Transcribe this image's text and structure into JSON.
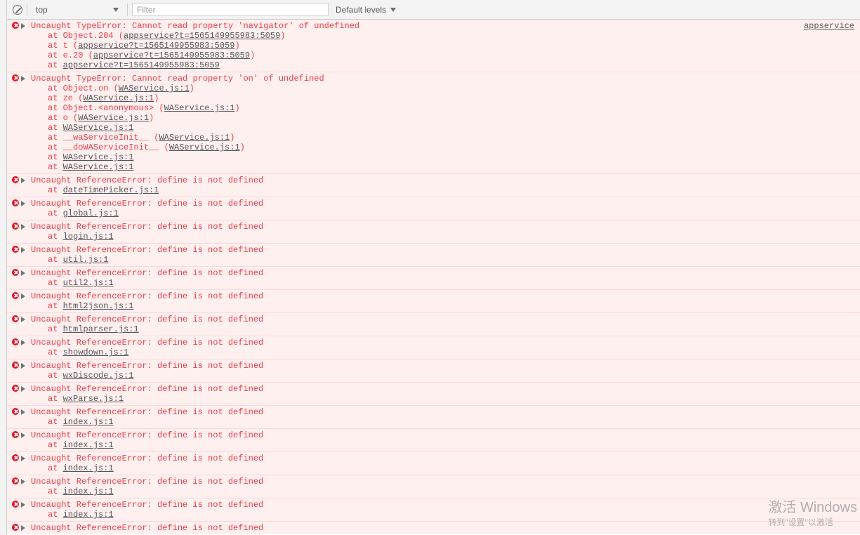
{
  "toolbar": {
    "context": "top",
    "filter_placeholder": "Filter",
    "levels_label": "Default levels"
  },
  "source_link_right": "appservice",
  "errors": [
    {
      "message": "Uncaught TypeError: Cannot read property 'navigator' of undefined",
      "show_source_right": true,
      "stack": [
        {
          "pre": "at Object.204 (",
          "link": "appservice?t=1565149955983:5059",
          "post": ")"
        },
        {
          "pre": "at t (",
          "link": "appservice?t=1565149955983:5059",
          "post": ")"
        },
        {
          "pre": "at e.20 (",
          "link": "appservice?t=1565149955983:5059",
          "post": ")"
        },
        {
          "pre": "at ",
          "link": "appservice?t=1565149955983:5059",
          "post": ""
        }
      ]
    },
    {
      "message": "Uncaught TypeError: Cannot read property 'on' of undefined",
      "stack": [
        {
          "pre": "at Object.on (",
          "link": "WAService.js:1",
          "post": ")"
        },
        {
          "pre": "at ze (",
          "link": "WAService.js:1",
          "post": ")"
        },
        {
          "pre": "at Object.<anonymous> (",
          "link": "WAService.js:1",
          "post": ")"
        },
        {
          "pre": "at o (",
          "link": "WAService.js:1",
          "post": ")"
        },
        {
          "pre": "at ",
          "link": "WAService.js:1",
          "post": ""
        },
        {
          "pre": "at __waServiceInit__ (",
          "link": "WAService.js:1",
          "post": ")"
        },
        {
          "pre": "at __doWAServiceInit__ (",
          "link": "WAService.js:1",
          "post": ")"
        },
        {
          "pre": "at ",
          "link": "WAService.js:1",
          "post": ""
        },
        {
          "pre": "at ",
          "link": "WAService.js:1",
          "post": ""
        }
      ]
    },
    {
      "message": "Uncaught ReferenceError: define is not defined",
      "stack": [
        {
          "pre": "at ",
          "link": "dateTimePicker.js:1",
          "post": ""
        }
      ]
    },
    {
      "message": "Uncaught ReferenceError: define is not defined",
      "stack": [
        {
          "pre": "at ",
          "link": "global.js:1",
          "post": ""
        }
      ]
    },
    {
      "message": "Uncaught ReferenceError: define is not defined",
      "stack": [
        {
          "pre": "at ",
          "link": "login.js:1",
          "post": ""
        }
      ]
    },
    {
      "message": "Uncaught ReferenceError: define is not defined",
      "stack": [
        {
          "pre": "at ",
          "link": "util.js:1",
          "post": ""
        }
      ]
    },
    {
      "message": "Uncaught ReferenceError: define is not defined",
      "stack": [
        {
          "pre": "at ",
          "link": "util2.js:1",
          "post": ""
        }
      ]
    },
    {
      "message": "Uncaught ReferenceError: define is not defined",
      "stack": [
        {
          "pre": "at ",
          "link": "html2json.js:1",
          "post": ""
        }
      ]
    },
    {
      "message": "Uncaught ReferenceError: define is not defined",
      "stack": [
        {
          "pre": "at ",
          "link": "htmlparser.js:1",
          "post": ""
        }
      ]
    },
    {
      "message": "Uncaught ReferenceError: define is not defined",
      "stack": [
        {
          "pre": "at ",
          "link": "showdown.js:1",
          "post": ""
        }
      ]
    },
    {
      "message": "Uncaught ReferenceError: define is not defined",
      "stack": [
        {
          "pre": "at ",
          "link": "wxDiscode.js:1",
          "post": ""
        }
      ]
    },
    {
      "message": "Uncaught ReferenceError: define is not defined",
      "stack": [
        {
          "pre": "at ",
          "link": "wxParse.js:1",
          "post": ""
        }
      ]
    },
    {
      "message": "Uncaught ReferenceError: define is not defined",
      "stack": [
        {
          "pre": "at ",
          "link": "index.js:1",
          "post": ""
        }
      ]
    },
    {
      "message": "Uncaught ReferenceError: define is not defined",
      "stack": [
        {
          "pre": "at ",
          "link": "index.js:1",
          "post": ""
        }
      ]
    },
    {
      "message": "Uncaught ReferenceError: define is not defined",
      "stack": [
        {
          "pre": "at ",
          "link": "index.js:1",
          "post": ""
        }
      ]
    },
    {
      "message": "Uncaught ReferenceError: define is not defined",
      "stack": [
        {
          "pre": "at ",
          "link": "index.js:1",
          "post": ""
        }
      ]
    },
    {
      "message": "Uncaught ReferenceError: define is not defined",
      "stack": [
        {
          "pre": "at ",
          "link": "index.js:1",
          "post": ""
        }
      ]
    },
    {
      "message": "Uncaught ReferenceError: define is not defined",
      "stack": []
    }
  ],
  "watermark": {
    "line1": "激活 Windows",
    "line2": "转到\"设置\"以激活"
  }
}
